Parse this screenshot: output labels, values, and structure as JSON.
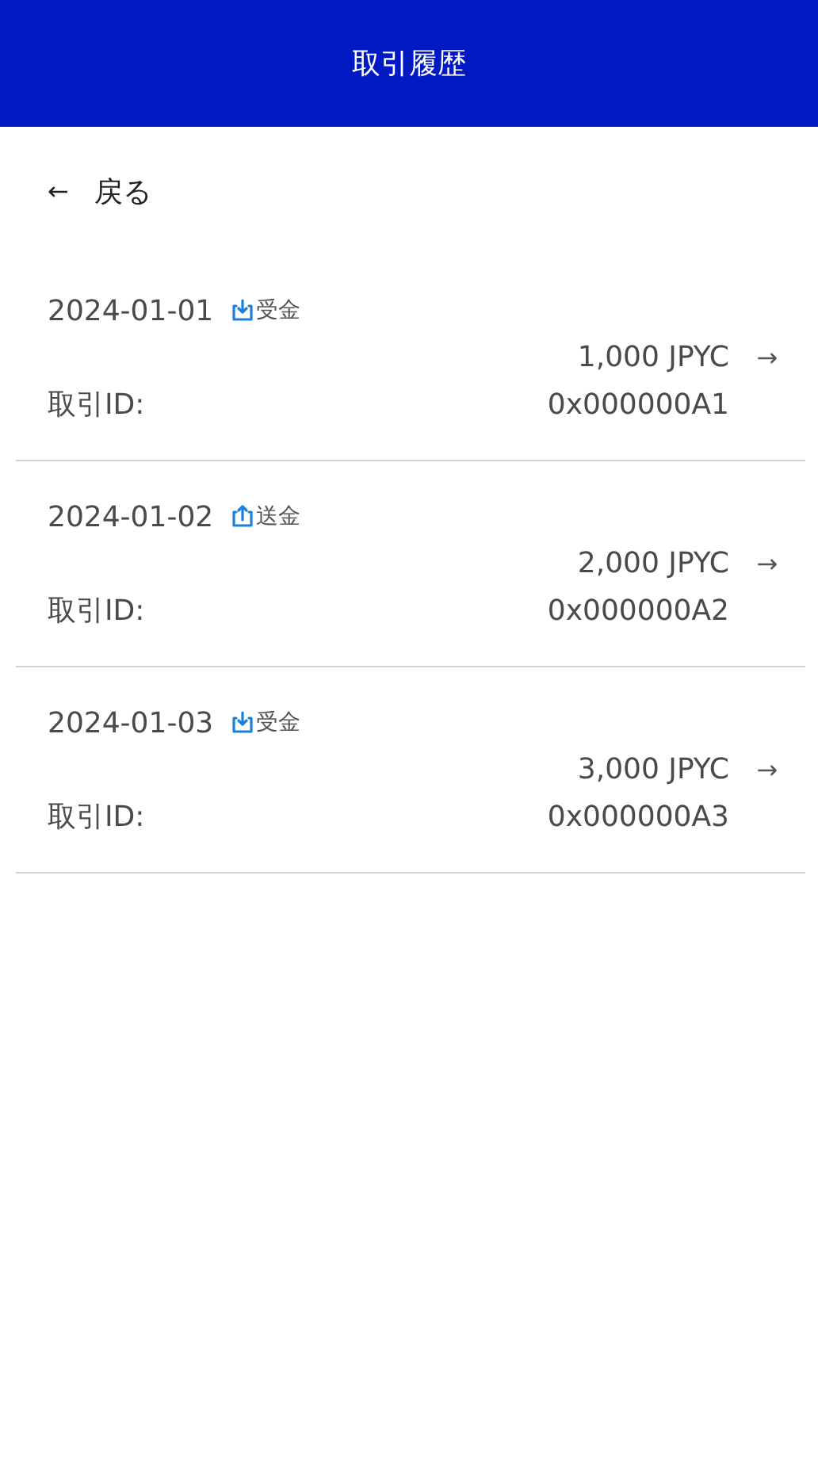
{
  "header": {
    "title": "取引履歴"
  },
  "back": {
    "arrow": "←",
    "label": "戻る"
  },
  "transactions": [
    {
      "date": "2024-01-01",
      "kind": "receive",
      "type_label": "受金",
      "amount": "1,000 JPYC",
      "arrow": "→",
      "id_label": "取引ID:",
      "id": "0x000000A1"
    },
    {
      "date": "2024-01-02",
      "kind": "send",
      "type_label": "送金",
      "amount": "2,000 JPYC",
      "arrow": "→",
      "id_label": "取引ID:",
      "id": "0x000000A2"
    },
    {
      "date": "2024-01-03",
      "kind": "receive",
      "type_label": "受金",
      "amount": "3,000 JPYC",
      "arrow": "→",
      "id_label": "取引ID:",
      "id": "0x000000A3"
    }
  ]
}
